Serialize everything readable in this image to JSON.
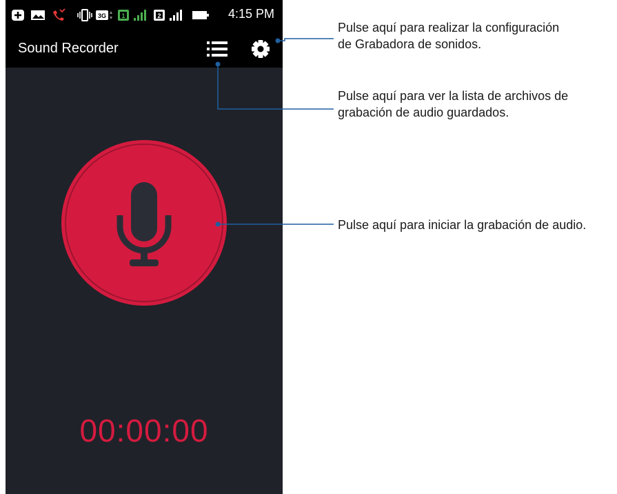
{
  "status_bar": {
    "time": "4:15 PM",
    "icons": [
      "plus-badge-icon",
      "image-icon",
      "missed-call-icon",
      "vibrate-icon",
      "3g-icon",
      "sim1-icon",
      "signal1-icon",
      "sim2-icon",
      "signal2-icon",
      "battery-icon"
    ]
  },
  "app_bar": {
    "title": "Sound Recorder",
    "list_icon": "list-icon",
    "settings_icon": "gear-icon"
  },
  "recorder": {
    "record_icon": "microphone-icon",
    "timer": "00:00:00"
  },
  "callouts": {
    "settings_line1": "Pulse aquí para realizar la configuración",
    "settings_line2": "de Grabadora de sonidos.",
    "list_line1": "Pulse aquí para ver la lista de archivos de",
    "list_line2": "grabación de audio guardados.",
    "record": "Pulse aquí para iniciar la grabación de audio."
  },
  "colors": {
    "record_red": "#d41b3f",
    "background": "#1f2229",
    "callout_line": "#1f5fa0"
  }
}
